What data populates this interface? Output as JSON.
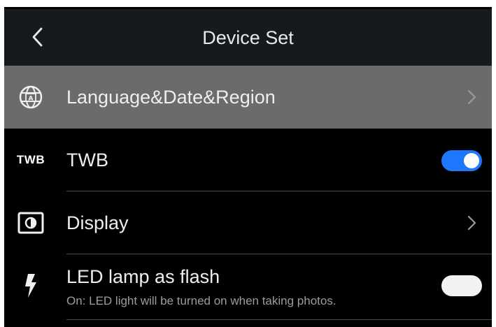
{
  "header": {
    "title": "Device Set",
    "back_icon": "chevron-left-icon"
  },
  "items": [
    {
      "label": "Language&Date&Region",
      "icon": "globe-language-icon",
      "selected": true,
      "control": "chevron"
    },
    {
      "label": "TWB",
      "icon_text": "TWB",
      "selected": false,
      "control": "toggle",
      "toggle_state": "on"
    },
    {
      "label": "Display",
      "icon": "display-brightness-icon",
      "selected": false,
      "control": "chevron"
    },
    {
      "label": "LED lamp as flash",
      "description": "On: LED light will be turned on when taking photos.",
      "icon": "flash-icon",
      "selected": false,
      "control": "toggle",
      "toggle_state": "off"
    }
  ],
  "colors": {
    "background": "#000000",
    "header": "#161a1d",
    "selected_row": "#6b6b6b",
    "toggle_on": "#1e78ff",
    "toggle_off": "#f2f2f2",
    "text": "#eeeeee",
    "secondary_text": "#9c9c9c"
  }
}
